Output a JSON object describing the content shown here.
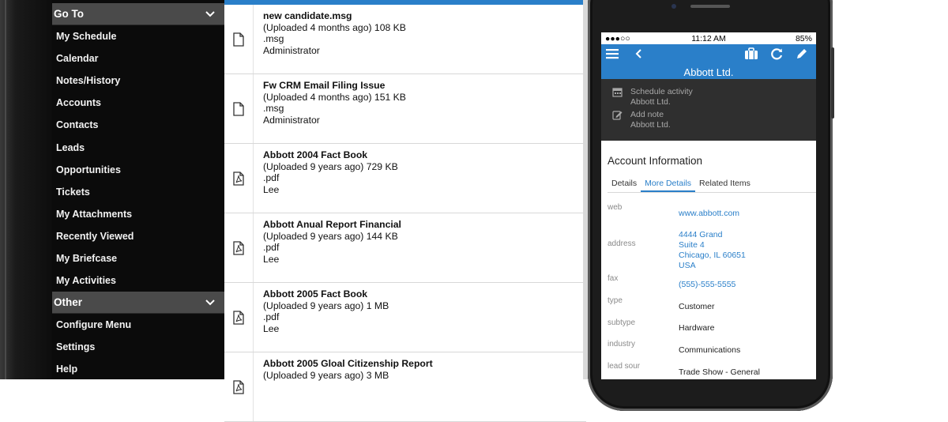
{
  "sidebar": {
    "goto_label": "Go To",
    "other_label": "Other",
    "goto_items": [
      "My Schedule",
      "Calendar",
      "Notes/History",
      "Accounts",
      "Contacts",
      "Leads",
      "Opportunities",
      "Tickets",
      "My Attachments",
      "Recently Viewed",
      "My Briefcase",
      "My Activities"
    ],
    "other_items": [
      "Configure Menu",
      "Settings",
      "Help"
    ]
  },
  "attachments": [
    {
      "title": "new candidate.msg",
      "meta": "(Uploaded 4 months ago) 108 KB",
      "ext": ".msg",
      "owner": "Administrator",
      "icon": "document-icon"
    },
    {
      "title": "Fw CRM Email Filing Issue",
      "meta": "(Uploaded 4 months ago) 151 KB",
      "ext": ".msg",
      "owner": "Administrator",
      "icon": "document-icon"
    },
    {
      "title": "Abbott 2004 Fact Book",
      "meta": "(Uploaded 9 years ago) 729 KB",
      "ext": ".pdf",
      "owner": "Lee",
      "icon": "pdf-icon"
    },
    {
      "title": "Abbott Anual Report Financial",
      "meta": "(Uploaded 9 years ago) 144 KB",
      "ext": ".pdf",
      "owner": "Lee",
      "icon": "pdf-icon"
    },
    {
      "title": "Abbott 2005 Fact Book",
      "meta": "(Uploaded 9 years ago) 1 MB",
      "ext": ".pdf",
      "owner": "Lee",
      "icon": "pdf-icon"
    },
    {
      "title": "Abbott 2005 Gloal Citizenship Report",
      "meta": "(Uploaded 9 years ago) 3 MB",
      "ext": "",
      "owner": "",
      "icon": "pdf-icon"
    }
  ],
  "phone": {
    "status": {
      "signal": "●●●○○",
      "time": "11:12 AM",
      "battery": "85%"
    },
    "title": "Abbott Ltd.",
    "actions": [
      {
        "label": "Schedule activity",
        "sub": "Abbott Ltd."
      },
      {
        "label": "Add note",
        "sub": "Abbott Ltd."
      }
    ],
    "section_title": "Account Information",
    "tabs": [
      "Details",
      "More Details",
      "Related Items"
    ],
    "active_tab": 1,
    "fields": {
      "web": {
        "label": "web",
        "value": "www.abbott.com"
      },
      "address": {
        "label": "address",
        "line1": "4444 Grand",
        "line2": "Suite 4",
        "line3": "Chicago, IL 60651",
        "line4": "USA"
      },
      "fax": {
        "label": "fax",
        "value": "(555)-555-5555"
      },
      "type": {
        "label": "type",
        "value": "Customer"
      },
      "subtype": {
        "label": "subtype",
        "value": "Hardware"
      },
      "industry": {
        "label": "industry",
        "value": "Communications"
      },
      "lead_source": {
        "label": "lead sour",
        "value": "Trade Show - General"
      }
    }
  },
  "colors": {
    "accent": "#2a7fc9",
    "sidebar_bg": "#0b0b0b",
    "sidebar_header": "#4a4a4a",
    "action_bg": "#2f2f2f"
  }
}
